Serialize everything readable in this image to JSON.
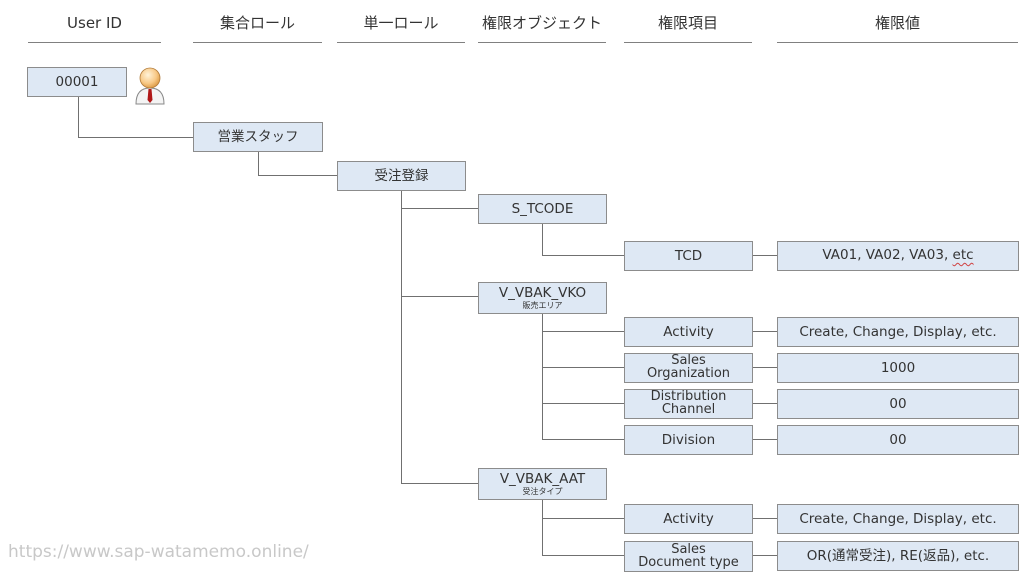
{
  "headers": {
    "user_id": "User ID",
    "composite_role": "集合ロール",
    "single_role": "単一ロール",
    "auth_object": "権限オブジェクト",
    "auth_field": "権限項目",
    "auth_value": "権限値"
  },
  "user": {
    "id": "00001",
    "icon": "user-avatar-icon"
  },
  "composite_role": {
    "label": "営業スタッフ"
  },
  "single_role": {
    "label": "受注登録"
  },
  "auth_objects": [
    {
      "name": "S_TCODE",
      "subtitle": "",
      "fields": [
        {
          "field": "TCD",
          "value_main": "VA01, VA02, VA03, ",
          "value_etc": "etc"
        }
      ]
    },
    {
      "name": "V_VBAK_VKO",
      "subtitle": "販売エリア",
      "fields": [
        {
          "field": "Activity",
          "value": "Create, Change, Display, etc."
        },
        {
          "field_line1": "Sales",
          "field_line2": "Organization",
          "value": "1000"
        },
        {
          "field_line1": "Distribution",
          "field_line2": "Channel",
          "value": "00"
        },
        {
          "field": "Division",
          "value": "00"
        }
      ]
    },
    {
      "name": "V_VBAK_AAT",
      "subtitle": "受注タイプ",
      "fields": [
        {
          "field": "Activity",
          "value": "Create, Change, Display, etc."
        },
        {
          "field_line1": "Sales",
          "field_line2": "Document type",
          "value": "OR(通常受注), RE(返品), etc."
        }
      ]
    }
  ],
  "watermark": "https://www.sap-watamemo.online/",
  "colors": {
    "box_fill": "#dee8f4",
    "box_border": "#8c8c8c",
    "connector": "#707070",
    "watermark": "#c8c8c8"
  }
}
